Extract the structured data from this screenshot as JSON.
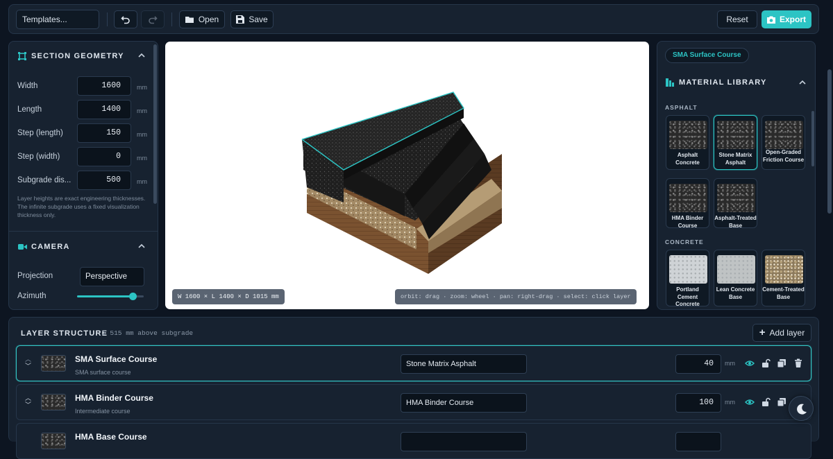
{
  "toolbar": {
    "templates": "Templates...",
    "open": "Open",
    "save": "Save",
    "reset": "Reset",
    "export": "Export"
  },
  "geometry": {
    "title": "SECTION GEOMETRY",
    "fields": [
      {
        "label": "Width",
        "value": "1600",
        "unit": "mm"
      },
      {
        "label": "Length",
        "value": "1400",
        "unit": "mm"
      },
      {
        "label": "Step (length)",
        "value": "150",
        "unit": "mm"
      },
      {
        "label": "Step (width)",
        "value": "0",
        "unit": "mm"
      },
      {
        "label": "Subgrade dis...",
        "value": "500",
        "unit": "mm"
      }
    ],
    "note": "Layer heights are exact engineering thicknesses. The infinite subgrade uses a fixed visualization thickness only."
  },
  "camera": {
    "title": "CAMERA",
    "projection_label": "Projection",
    "projection_value": "Perspective",
    "azimuth_label": "Azimuth",
    "azimuth_value": 0.83
  },
  "viewport": {
    "dims": "W 1600 × L 1400 × D 1015 mm",
    "hint": "orbit: drag · zoom: wheel · pan: right-drag · select: click layer"
  },
  "library": {
    "selected_chip": "SMA Surface Course",
    "title": "MATERIAL LIBRARY",
    "groups": [
      {
        "name": "ASPHALT",
        "items": [
          "Asphalt Concrete",
          "Stone Matrix Asphalt",
          "Open-Graded Friction Course",
          "HMA Binder Course",
          "Asphalt-Treated Base"
        ]
      },
      {
        "name": "CONCRETE",
        "items": [
          "Portland Cement Concrete",
          "Lean Concrete Base",
          "Cement-Treated Base"
        ]
      }
    ]
  },
  "layers": {
    "title": "LAYER STRUCTURE",
    "summary": "Σ 515 mm above subgrade",
    "add": "Add layer",
    "rows": [
      {
        "name": "SMA Surface Course",
        "sub": "SMA surface course",
        "material": "Stone Matrix Asphalt",
        "thickness": "40",
        "unit": "mm"
      },
      {
        "name": "HMA Binder Course",
        "sub": "Intermediate course",
        "material": "HMA Binder Course",
        "thickness": "100",
        "unit": "mm"
      },
      {
        "name": "HMA Base Course",
        "sub": "",
        "material": "",
        "thickness": "",
        "unit": ""
      }
    ]
  }
}
